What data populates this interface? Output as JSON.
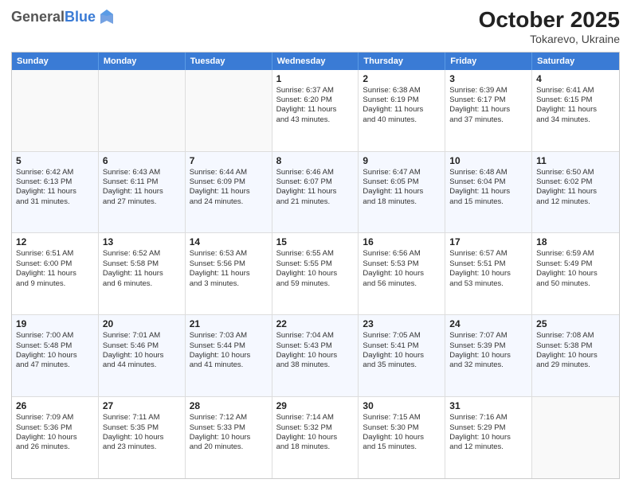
{
  "header": {
    "logo_general": "General",
    "logo_blue": "Blue",
    "month": "October 2025",
    "location": "Tokarevo, Ukraine"
  },
  "days_of_week": [
    "Sunday",
    "Monday",
    "Tuesday",
    "Wednesday",
    "Thursday",
    "Friday",
    "Saturday"
  ],
  "rows": [
    [
      {
        "day": "",
        "lines": []
      },
      {
        "day": "",
        "lines": []
      },
      {
        "day": "",
        "lines": []
      },
      {
        "day": "1",
        "lines": [
          "Sunrise: 6:37 AM",
          "Sunset: 6:20 PM",
          "Daylight: 11 hours",
          "and 43 minutes."
        ]
      },
      {
        "day": "2",
        "lines": [
          "Sunrise: 6:38 AM",
          "Sunset: 6:19 PM",
          "Daylight: 11 hours",
          "and 40 minutes."
        ]
      },
      {
        "day": "3",
        "lines": [
          "Sunrise: 6:39 AM",
          "Sunset: 6:17 PM",
          "Daylight: 11 hours",
          "and 37 minutes."
        ]
      },
      {
        "day": "4",
        "lines": [
          "Sunrise: 6:41 AM",
          "Sunset: 6:15 PM",
          "Daylight: 11 hours",
          "and 34 minutes."
        ]
      }
    ],
    [
      {
        "day": "5",
        "lines": [
          "Sunrise: 6:42 AM",
          "Sunset: 6:13 PM",
          "Daylight: 11 hours",
          "and 31 minutes."
        ]
      },
      {
        "day": "6",
        "lines": [
          "Sunrise: 6:43 AM",
          "Sunset: 6:11 PM",
          "Daylight: 11 hours",
          "and 27 minutes."
        ]
      },
      {
        "day": "7",
        "lines": [
          "Sunrise: 6:44 AM",
          "Sunset: 6:09 PM",
          "Daylight: 11 hours",
          "and 24 minutes."
        ]
      },
      {
        "day": "8",
        "lines": [
          "Sunrise: 6:46 AM",
          "Sunset: 6:07 PM",
          "Daylight: 11 hours",
          "and 21 minutes."
        ]
      },
      {
        "day": "9",
        "lines": [
          "Sunrise: 6:47 AM",
          "Sunset: 6:05 PM",
          "Daylight: 11 hours",
          "and 18 minutes."
        ]
      },
      {
        "day": "10",
        "lines": [
          "Sunrise: 6:48 AM",
          "Sunset: 6:04 PM",
          "Daylight: 11 hours",
          "and 15 minutes."
        ]
      },
      {
        "day": "11",
        "lines": [
          "Sunrise: 6:50 AM",
          "Sunset: 6:02 PM",
          "Daylight: 11 hours",
          "and 12 minutes."
        ]
      }
    ],
    [
      {
        "day": "12",
        "lines": [
          "Sunrise: 6:51 AM",
          "Sunset: 6:00 PM",
          "Daylight: 11 hours",
          "and 9 minutes."
        ]
      },
      {
        "day": "13",
        "lines": [
          "Sunrise: 6:52 AM",
          "Sunset: 5:58 PM",
          "Daylight: 11 hours",
          "and 6 minutes."
        ]
      },
      {
        "day": "14",
        "lines": [
          "Sunrise: 6:53 AM",
          "Sunset: 5:56 PM",
          "Daylight: 11 hours",
          "and 3 minutes."
        ]
      },
      {
        "day": "15",
        "lines": [
          "Sunrise: 6:55 AM",
          "Sunset: 5:55 PM",
          "Daylight: 10 hours",
          "and 59 minutes."
        ]
      },
      {
        "day": "16",
        "lines": [
          "Sunrise: 6:56 AM",
          "Sunset: 5:53 PM",
          "Daylight: 10 hours",
          "and 56 minutes."
        ]
      },
      {
        "day": "17",
        "lines": [
          "Sunrise: 6:57 AM",
          "Sunset: 5:51 PM",
          "Daylight: 10 hours",
          "and 53 minutes."
        ]
      },
      {
        "day": "18",
        "lines": [
          "Sunrise: 6:59 AM",
          "Sunset: 5:49 PM",
          "Daylight: 10 hours",
          "and 50 minutes."
        ]
      }
    ],
    [
      {
        "day": "19",
        "lines": [
          "Sunrise: 7:00 AM",
          "Sunset: 5:48 PM",
          "Daylight: 10 hours",
          "and 47 minutes."
        ]
      },
      {
        "day": "20",
        "lines": [
          "Sunrise: 7:01 AM",
          "Sunset: 5:46 PM",
          "Daylight: 10 hours",
          "and 44 minutes."
        ]
      },
      {
        "day": "21",
        "lines": [
          "Sunrise: 7:03 AM",
          "Sunset: 5:44 PM",
          "Daylight: 10 hours",
          "and 41 minutes."
        ]
      },
      {
        "day": "22",
        "lines": [
          "Sunrise: 7:04 AM",
          "Sunset: 5:43 PM",
          "Daylight: 10 hours",
          "and 38 minutes."
        ]
      },
      {
        "day": "23",
        "lines": [
          "Sunrise: 7:05 AM",
          "Sunset: 5:41 PM",
          "Daylight: 10 hours",
          "and 35 minutes."
        ]
      },
      {
        "day": "24",
        "lines": [
          "Sunrise: 7:07 AM",
          "Sunset: 5:39 PM",
          "Daylight: 10 hours",
          "and 32 minutes."
        ]
      },
      {
        "day": "25",
        "lines": [
          "Sunrise: 7:08 AM",
          "Sunset: 5:38 PM",
          "Daylight: 10 hours",
          "and 29 minutes."
        ]
      }
    ],
    [
      {
        "day": "26",
        "lines": [
          "Sunrise: 7:09 AM",
          "Sunset: 5:36 PM",
          "Daylight: 10 hours",
          "and 26 minutes."
        ]
      },
      {
        "day": "27",
        "lines": [
          "Sunrise: 7:11 AM",
          "Sunset: 5:35 PM",
          "Daylight: 10 hours",
          "and 23 minutes."
        ]
      },
      {
        "day": "28",
        "lines": [
          "Sunrise: 7:12 AM",
          "Sunset: 5:33 PM",
          "Daylight: 10 hours",
          "and 20 minutes."
        ]
      },
      {
        "day": "29",
        "lines": [
          "Sunrise: 7:14 AM",
          "Sunset: 5:32 PM",
          "Daylight: 10 hours",
          "and 18 minutes."
        ]
      },
      {
        "day": "30",
        "lines": [
          "Sunrise: 7:15 AM",
          "Sunset: 5:30 PM",
          "Daylight: 10 hours",
          "and 15 minutes."
        ]
      },
      {
        "day": "31",
        "lines": [
          "Sunrise: 7:16 AM",
          "Sunset: 5:29 PM",
          "Daylight: 10 hours",
          "and 12 minutes."
        ]
      },
      {
        "day": "",
        "lines": []
      }
    ]
  ]
}
